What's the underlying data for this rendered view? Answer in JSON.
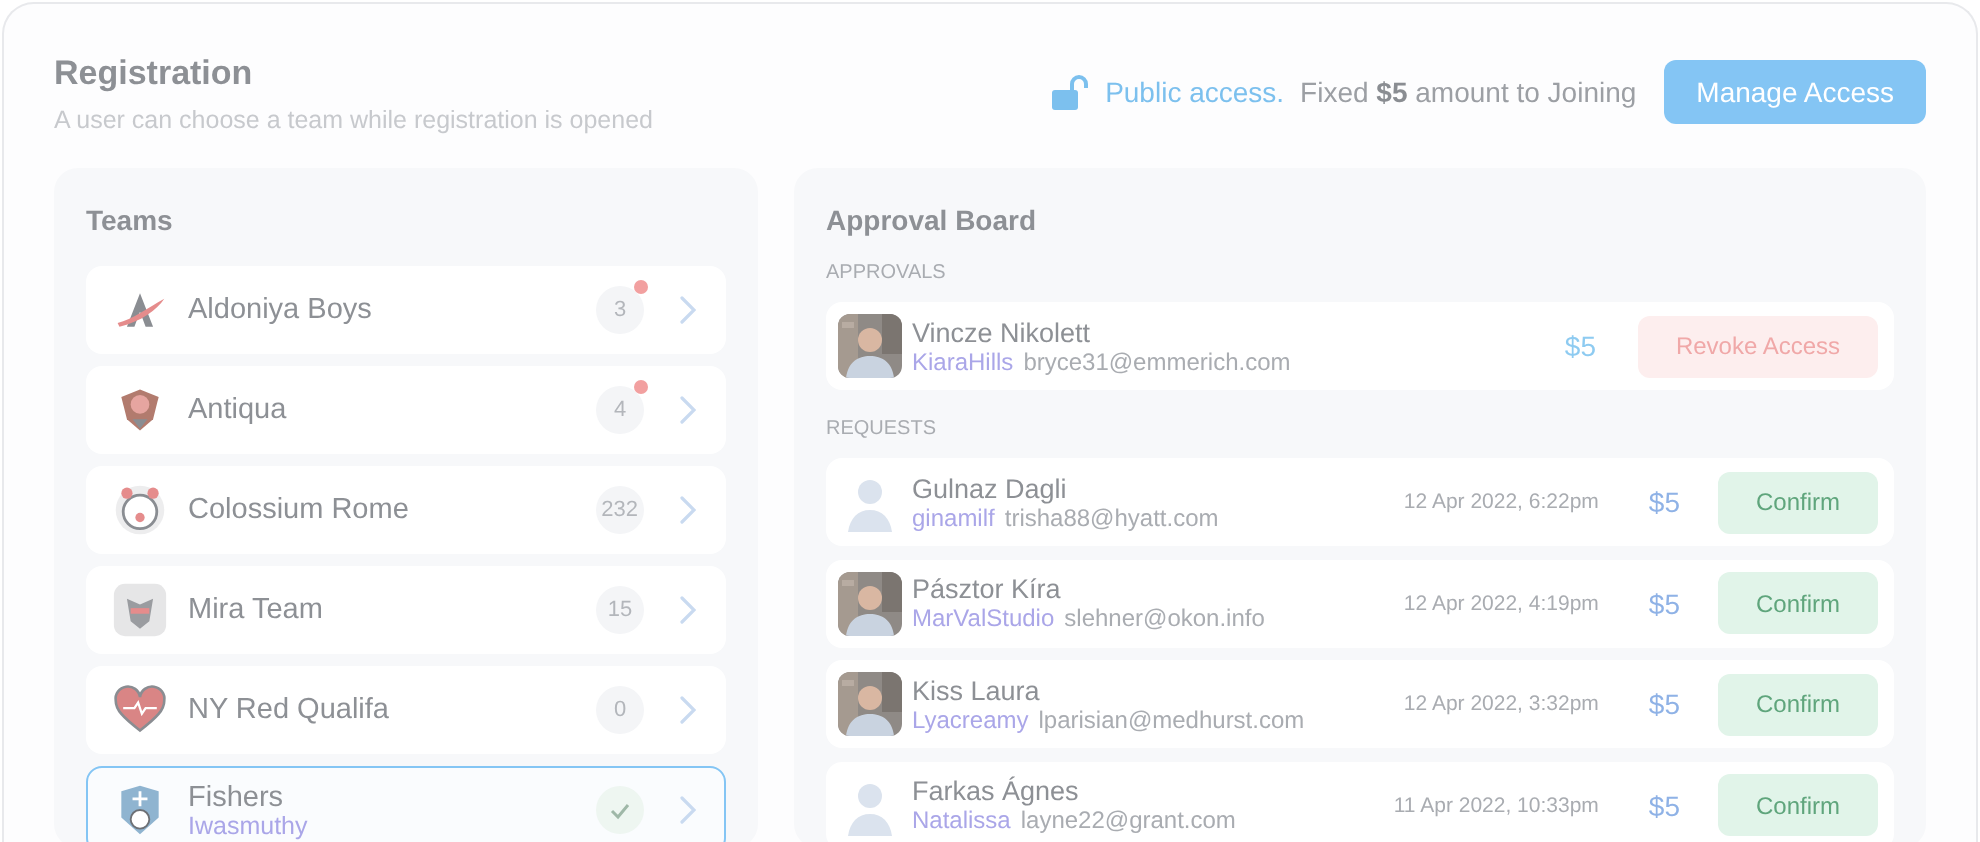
{
  "header": {
    "title": "Registration",
    "subtitle": "A user can choose a team while registration is opened",
    "access_label": "Public access.",
    "access_text": "Fixed **$5** amount to Joining",
    "button": "Manage Access"
  },
  "teams": {
    "title": "Teams",
    "items": [
      {
        "name": "Aldoniya Boys",
        "count": "3",
        "alert": true,
        "selected": false,
        "kind": "count"
      },
      {
        "name": "Antiqua",
        "count": "4",
        "alert": true,
        "selected": false,
        "kind": "count"
      },
      {
        "name": "Colossium Rome",
        "count": "232",
        "alert": false,
        "selected": false,
        "kind": "count"
      },
      {
        "name": "Mira Team",
        "count": "15",
        "alert": false,
        "selected": false,
        "kind": "count"
      },
      {
        "name": "NY Red Qualifa",
        "count": "0",
        "alert": false,
        "selected": false,
        "kind": "count"
      },
      {
        "name": "Fishers",
        "subtitle": "Iwasmuthy",
        "selected": true,
        "kind": "check"
      }
    ]
  },
  "approval_board": {
    "title": "Approval Board",
    "approvals_label": "APPROVALS",
    "approvals": [
      {
        "name": "Vincze Nikolett",
        "username": "KiaraHills",
        "email": "bryce31@emmerich.com",
        "amount": "$5",
        "button": "Revoke Access"
      }
    ],
    "requests_label": "REQUESTS",
    "requests": [
      {
        "name": "Gulnaz Dagli",
        "username": "ginamilf",
        "email": "trisha88@hyatt.com",
        "date": "12 Apr 2022, 6:22pm",
        "amount": "$5",
        "button": "Confirm",
        "kind": "placeholder"
      },
      {
        "name": "Pásztor Kíra",
        "username": "MarValStudio",
        "email": "slehner@okon.info",
        "date": "12 Apr 2022, 4:19pm",
        "amount": "$5",
        "button": "Confirm"
      },
      {
        "name": "Kiss Laura",
        "username": "Lyacreamy",
        "email": "lparisian@medhurst.com",
        "date": "12 Apr 2022, 3:32pm",
        "amount": "$5",
        "button": "Confirm"
      },
      {
        "name": "Farkas Ágnes",
        "username": "Natalissa",
        "email": "layne22@grant.com",
        "date": "11 Apr 2022, 10:33pm",
        "amount": "$5",
        "button": "Confirm",
        "kind": "placeholder"
      }
    ]
  }
}
